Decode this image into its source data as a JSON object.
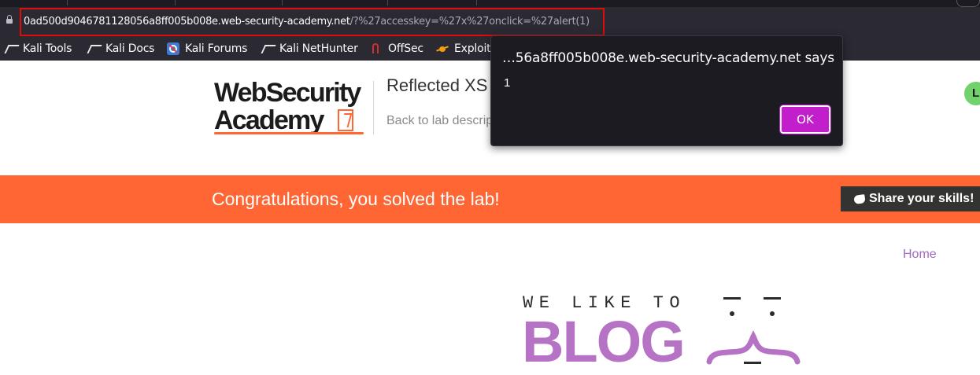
{
  "browser": {
    "url_host": "0ad500d9046781128056a8ff005b008e.web-security-academy.net",
    "url_path": "/?%27accesskey=%27x%27onclick=%27alert(1)",
    "bookmarks": [
      {
        "label": "Kali Tools",
        "icon": "kali-dragon-icon"
      },
      {
        "label": "Kali Docs",
        "icon": "kali-docs-icon"
      },
      {
        "label": "Kali Forums",
        "icon": "kali-dragon-icon"
      },
      {
        "label": "Kali NetHunter",
        "icon": "kali-dragon-icon"
      },
      {
        "label": "OffSec",
        "icon": "offsec-icon"
      },
      {
        "label": "Exploit",
        "icon": "exploit-spider-icon"
      }
    ],
    "url_highlight_color": "#e00b0b"
  },
  "header": {
    "logo_line1": "WebSecurity",
    "logo_line2": "Academy",
    "lab_title": "Reflected XS",
    "back_link": "Back to lab descrip",
    "avatar_letter": "L"
  },
  "banner": {
    "message": "Congratulations, you solved the lab!",
    "share_label": "Share your skills!",
    "color": "#ff6633"
  },
  "blog": {
    "home_link": "Home",
    "tagline": "WE LIKE TO",
    "word": "BLOG",
    "accent_color": "#b672c5"
  },
  "dialog": {
    "title": "…56a8ff005b008e.web-security-academy.net says",
    "message": "1",
    "ok_label": "OK",
    "button_color": "#c21ecc"
  }
}
